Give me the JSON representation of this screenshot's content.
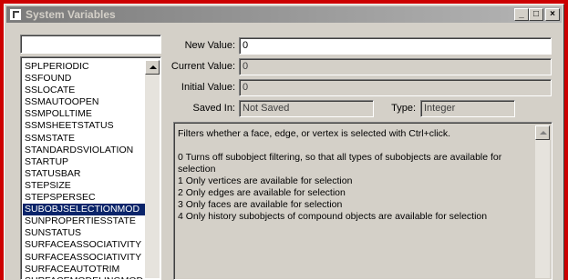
{
  "window": {
    "title": "System Variables",
    "buttons": {
      "minimize": "_",
      "maximize": "□",
      "close": "×"
    }
  },
  "search": {
    "value": ""
  },
  "variables": [
    "SPLPERIODIC",
    "SSFOUND",
    "SSLOCATE",
    "SSMAUTOOPEN",
    "SSMPOLLTIME",
    "SSMSHEETSTATUS",
    "SSMSTATE",
    "STANDARDSVIOLATION",
    "STARTUP",
    "STATUSBAR",
    "STEPSIZE",
    "STEPSPERSEC",
    "SUBOBJSELECTIONMOD",
    "SUNPROPERTIESSTATE",
    "SUNSTATUS",
    "SURFACEASSOCIATIVITY",
    "SURFACEASSOCIATIVITY",
    "SURFACEAUTOTRIM",
    "SURFACEMODELINGMOD"
  ],
  "selected_index": 12,
  "fields": {
    "new_value_label": "New Value:",
    "new_value": "0",
    "current_value_label": "Current Value:",
    "current_value": "0",
    "initial_value_label": "Initial Value:",
    "initial_value": "0",
    "saved_in_label": "Saved In:",
    "saved_in": "Not Saved",
    "type_label": "Type:",
    "type": "Integer"
  },
  "description": {
    "summary": "Filters whether a face, edge, or vertex is selected with Ctrl+click.",
    "options": [
      "0    Turns off subobject filtering, so that all types of subobjects are available for selection",
      "1    Only vertices are available for selection",
      "2    Only edges are available for selection",
      "3    Only faces are available for selection",
      "4    Only history subobjects of compound objects are available for selection"
    ]
  }
}
